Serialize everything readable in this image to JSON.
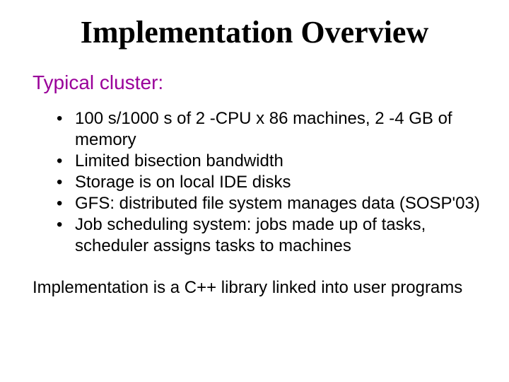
{
  "title": "Implementation Overview",
  "section_label": "Typical cluster:",
  "bullets": [
    "100 s/1000 s of 2 -CPU x 86 machines, 2 -4 GB of memory",
    "Limited bisection bandwidth",
    "Storage is on local IDE disks",
    "GFS: distributed file system manages data (SOSP'03)",
    "Job scheduling system: jobs made up of tasks, scheduler assigns tasks to machines"
  ],
  "footer": "Implementation is a C++ library linked into user programs"
}
